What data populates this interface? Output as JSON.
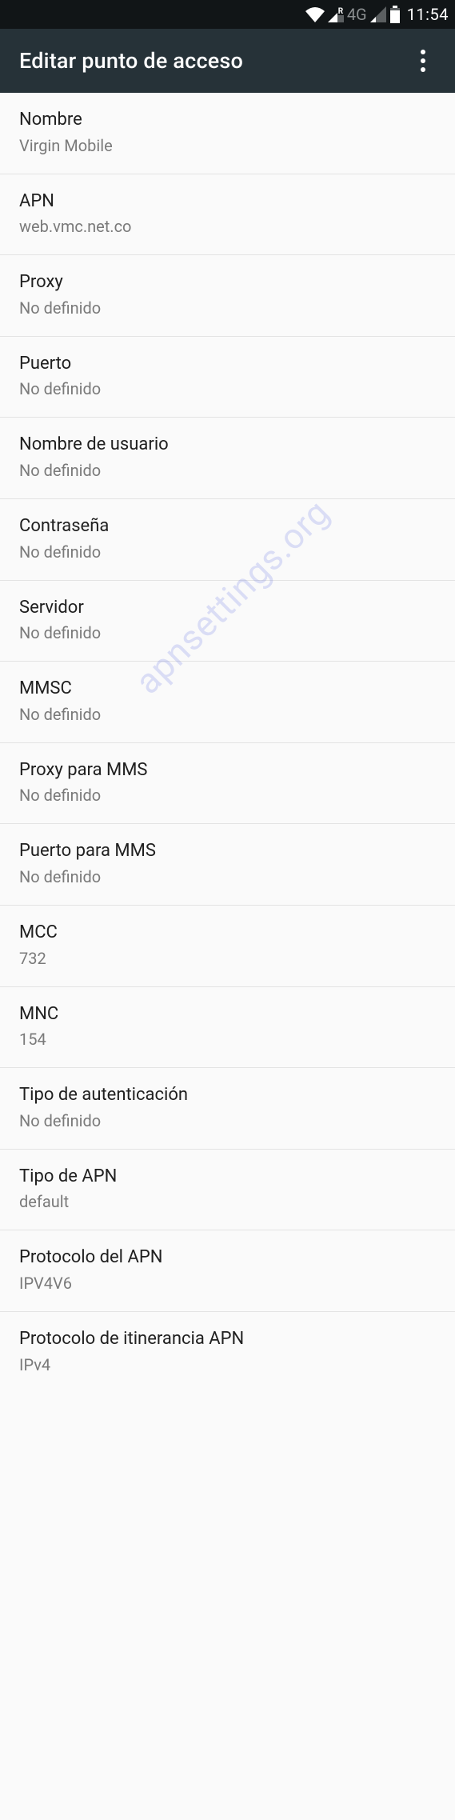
{
  "status": {
    "network_label": "4G",
    "time": "11:54"
  },
  "appbar": {
    "title": "Editar punto de acceso"
  },
  "watermark": "apnsettings.org",
  "fields": {
    "nombre": {
      "label": "Nombre",
      "value": "Virgin Mobile"
    },
    "apn": {
      "label": "APN",
      "value": "web.vmc.net.co"
    },
    "proxy": {
      "label": "Proxy",
      "value": "No definido"
    },
    "puerto": {
      "label": "Puerto",
      "value": "No definido"
    },
    "usuario": {
      "label": "Nombre de usuario",
      "value": "No definido"
    },
    "contrasena": {
      "label": "Contraseña",
      "value": "No definido"
    },
    "servidor": {
      "label": "Servidor",
      "value": "No definido"
    },
    "mmsc": {
      "label": "MMSC",
      "value": "No definido"
    },
    "mmsproxy": {
      "label": "Proxy para MMS",
      "value": "No definido"
    },
    "mmspuerto": {
      "label": "Puerto para MMS",
      "value": "No definido"
    },
    "mcc": {
      "label": "MCC",
      "value": "732"
    },
    "mnc": {
      "label": "MNC",
      "value": "154"
    },
    "auth": {
      "label": "Tipo de autenticación",
      "value": "No definido"
    },
    "apntype": {
      "label": "Tipo de APN",
      "value": "default"
    },
    "apnproto": {
      "label": "Protocolo del APN",
      "value": "IPV4V6"
    },
    "roamproto": {
      "label": "Protocolo de itinerancia APN",
      "value": "IPv4"
    }
  }
}
